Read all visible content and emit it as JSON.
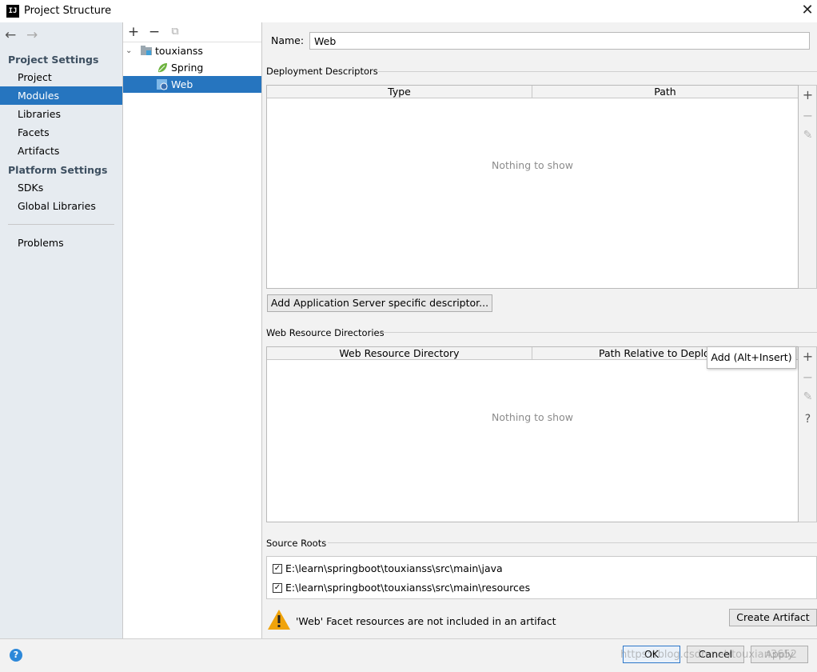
{
  "window": {
    "title": "Project Structure",
    "app_icon_text": "IJ",
    "close_glyph": "✕"
  },
  "nav": {
    "back": "←",
    "forward": "→"
  },
  "sidebar": {
    "project_settings_header": "Project Settings",
    "project_items": [
      "Project",
      "Modules",
      "Libraries",
      "Facets",
      "Artifacts"
    ],
    "platform_settings_header": "Platform Settings",
    "platform_items": [
      "SDKs",
      "Global Libraries"
    ],
    "problems": "Problems",
    "selected": "Modules"
  },
  "tree_toolbar": {
    "add": "+",
    "remove": "−",
    "copy": "⧉"
  },
  "tree": {
    "root": "touxianss",
    "children": [
      "Spring",
      "Web"
    ],
    "selected": "Web"
  },
  "name_field": {
    "label": "Name:",
    "value": "Web"
  },
  "deployment": {
    "title": "Deployment Descriptors",
    "columns": [
      "Type",
      "Path"
    ],
    "empty_text": "Nothing to show",
    "add_button": "Add Application Server specific descriptor..."
  },
  "web_resources": {
    "title": "Web Resource Directories",
    "columns": [
      "Web Resource Directory",
      "Path Relative to Deployme"
    ],
    "empty_text": "Nothing to show",
    "tooltip": "Add (Alt+Insert)"
  },
  "tools": {
    "add": "+",
    "remove": "−",
    "edit": "✎",
    "help": "?"
  },
  "source_roots": {
    "title": "Source Roots",
    "items": [
      {
        "path": "E:\\learn\\springboot\\touxianss\\src\\main\\java",
        "checked": true
      },
      {
        "path": "E:\\learn\\springboot\\touxianss\\src\\main\\resources",
        "checked": true
      }
    ]
  },
  "warning": {
    "text": "'Web' Facet resources are not included in an artifact",
    "button": "Create Artifact"
  },
  "footer": {
    "help": "?",
    "ok": "OK",
    "cancel": "Cancel",
    "apply": "Apply"
  },
  "watermark": "https://blog.csdn.net/touxian3652",
  "colors": {
    "selection": "#2675bf",
    "sidebar_bg": "#e6ebf0",
    "warning": "#f0a30a"
  }
}
